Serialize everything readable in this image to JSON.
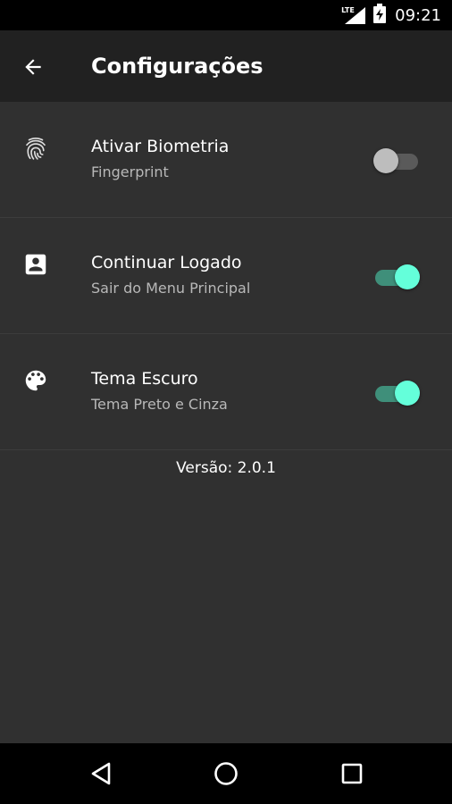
{
  "status_bar": {
    "network_label": "LTE",
    "time": "09:21",
    "icons": [
      "signal-icon",
      "battery-charging-icon"
    ]
  },
  "app_bar": {
    "title": "Configurações",
    "back_icon": "arrow-back-icon"
  },
  "settings": [
    {
      "icon": "fingerprint-icon",
      "title": "Ativar Biometria",
      "subtitle": "Fingerprint",
      "enabled": false
    },
    {
      "icon": "account-box-icon",
      "title": "Continuar Logado",
      "subtitle": "Sair do Menu Principal",
      "enabled": true
    },
    {
      "icon": "palette-icon",
      "title": "Tema Escuro",
      "subtitle": "Tema Preto e Cinza",
      "enabled": true
    }
  ],
  "version": "Versão: 2.0.1",
  "nav_bar": {
    "icons": [
      "back-triangle-icon",
      "home-circle-icon",
      "recents-square-icon"
    ]
  },
  "colors": {
    "background": "#303030",
    "app_bar": "#212121",
    "accent": "#64ffda",
    "accent_track": "#3f8f7a",
    "switch_off_thumb": "#bdbdbd",
    "switch_off_track": "#5a5a5a"
  }
}
